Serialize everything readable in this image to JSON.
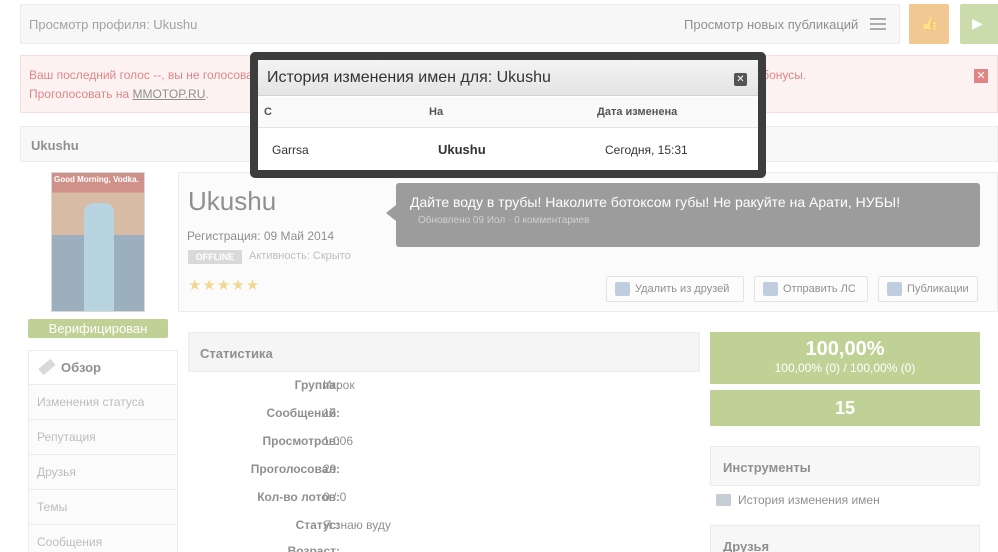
{
  "topbar": {
    "breadcrumb": "Просмотр профиля: Ukushu",
    "new_publications": "Просмотр новых публикаций"
  },
  "alert": {
    "line1_start": "Ваш последний голос --, вы не голосова",
    "line1_end": "и проекта, а вы получите бонусы.",
    "line2_prefix": "Проголосовать на ",
    "line2_link": "MMOTOP.RU",
    "line2_suffix": "."
  },
  "profile": {
    "header_name": "Ukushu",
    "avatar_caption": "Good Morning, Vodka.",
    "verified": "Верифицирован",
    "username": "Ukushu",
    "registration": "Регистрация: 09 Май 2014",
    "status_badge": "OFFLINE",
    "activity": "Активность: Скрыто",
    "stars": "★★★★★",
    "status_text": "Дайте воду в трубы! Наколите ботоксом губы! Не ракуйте на Арати, НУБЫ!",
    "status_meta": "Обновлено 09 Иол · 0 комментариев"
  },
  "actions": {
    "remove_friend": "Удалить из друзей",
    "send_pm": "Отправить ЛС",
    "publications": "Публикации"
  },
  "sidebar": {
    "items": [
      {
        "label": "Обзор"
      },
      {
        "label": "Изменения статуса"
      },
      {
        "label": "Репутация"
      },
      {
        "label": "Друзья"
      },
      {
        "label": "Темы"
      },
      {
        "label": "Сообщения"
      }
    ]
  },
  "stats": {
    "title": "Статистика",
    "rows": [
      {
        "key": "Группа:",
        "value": "Игрок"
      },
      {
        "key": "Сообщений:",
        "value": "16"
      },
      {
        "key": "Просмотров:",
        "value": "1 006"
      },
      {
        "key": "Проголосовал:",
        "value": "29"
      },
      {
        "key": "Кол-во лотов:",
        "value": "0 / 0"
      },
      {
        "key": "Статус:",
        "value": "Я знаю вуду"
      },
      {
        "key": "Возраст:",
        "value": ""
      }
    ]
  },
  "right": {
    "percent_big": "100,00%",
    "percent_small": "100,00% (0)  /  100,00% (0)",
    "count": "15",
    "tools_title": "Инструменты",
    "tools_item": "История изменения имен",
    "friends_title": "Друзья"
  },
  "modal": {
    "title": "История изменения имен для: Ukushu",
    "col_from": "С",
    "col_to": "На",
    "col_date": "Дата изменена",
    "row": {
      "from": "Garrsa",
      "to": "Ukushu",
      "date": "Сегодня, 15:31"
    }
  },
  "colors": {
    "accent_green": "#8dab3f",
    "alert_red": "#c62020",
    "orange": "#e69a3a"
  }
}
